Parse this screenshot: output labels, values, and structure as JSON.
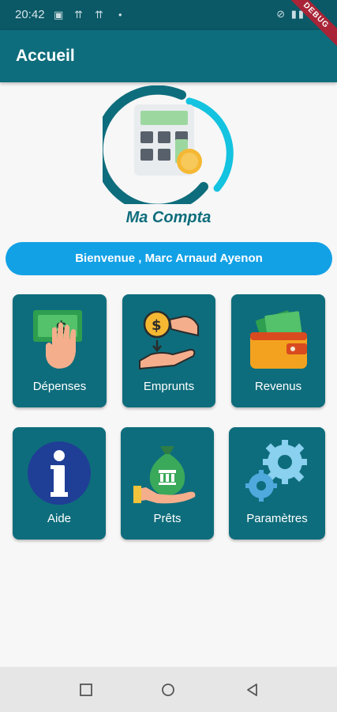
{
  "status_bar": {
    "time": "20:42"
  },
  "debug_banner": "DEBUG",
  "app_bar": {
    "title": "Accueil"
  },
  "logo": {
    "text": "Ma Compta"
  },
  "welcome": {
    "text": "Bienvenue , Marc Arnaud  Ayenon"
  },
  "tiles": [
    {
      "label": "Dépenses",
      "icon": "cash-hand-icon"
    },
    {
      "label": "Emprunts",
      "icon": "coin-exchange-icon"
    },
    {
      "label": "Revenus",
      "icon": "wallet-icon"
    },
    {
      "label": "Aide",
      "icon": "info-icon"
    },
    {
      "label": "Prêts",
      "icon": "money-bag-icon"
    },
    {
      "label": "Paramètres",
      "icon": "gears-icon"
    }
  ],
  "nav_bar": {
    "icons": [
      "recent-apps-icon",
      "home-icon",
      "back-icon"
    ]
  },
  "colors": {
    "primary": "#0e6d7c",
    "status_bar": "#0b5866",
    "accent": "#13a1e6"
  }
}
